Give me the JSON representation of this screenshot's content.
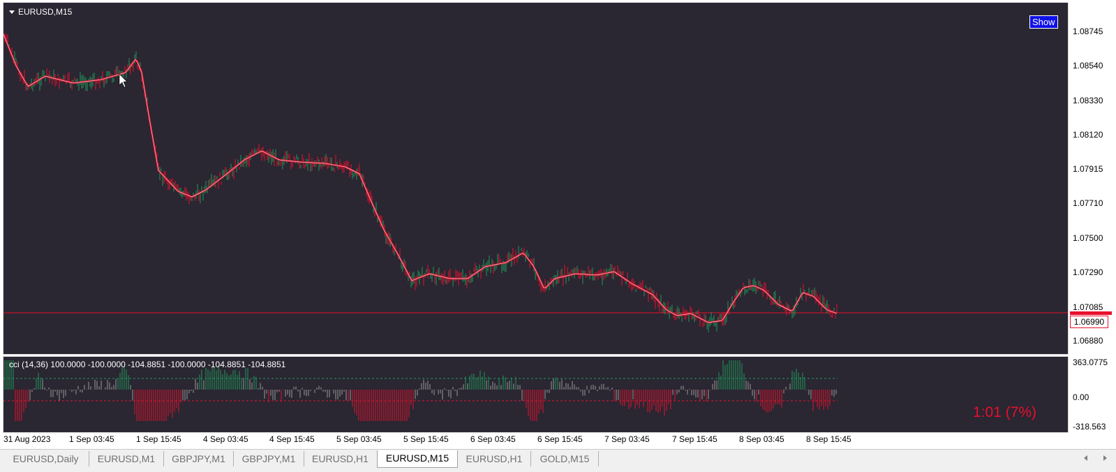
{
  "chart": {
    "symbol": "EURUSD,M15",
    "show_button": "Show",
    "price_axis": [
      "1.08745",
      "1.08540",
      "1.08330",
      "1.08120",
      "1.07915",
      "1.07710",
      "1.07500",
      "1.07290",
      "1.07085",
      "1.06880"
    ],
    "current_price": "1.06990",
    "time_axis": [
      "31 Aug 2023",
      "1 Sep 03:45",
      "1 Sep 15:45",
      "4 Sep 03:45",
      "4 Sep 15:45",
      "5 Sep 03:45",
      "5 Sep 15:45",
      "6 Sep 03:45",
      "6 Sep 15:45",
      "7 Sep 03:45",
      "7 Sep 15:45",
      "8 Sep 03:45",
      "8 Sep 15:45"
    ],
    "colors": {
      "background": "#2a2632",
      "bull": "#1f9a5a",
      "bear": "#e8102c",
      "ma_line": "#e8102c",
      "price_line": "#e8102c"
    }
  },
  "indicator": {
    "title": "cci  (14,36) 100.0000 -100.0000 -104.8851 -100.0000 -104.8851 -104.8851",
    "axis": [
      "363.0775",
      "0.00",
      "-318.563"
    ],
    "timer": "1:01 (7%)"
  },
  "tabs": [
    {
      "label": "EURUSD,Daily",
      "active": false
    },
    {
      "label": "EURUSD,M1",
      "active": false
    },
    {
      "label": "GBPJPY,M1",
      "active": false
    },
    {
      "label": "GBPJPY,M1",
      "active": false
    },
    {
      "label": "EURUSD,H1",
      "active": false
    },
    {
      "label": "EURUSD,M15",
      "active": true
    },
    {
      "label": "EURUSD,H1",
      "active": false
    },
    {
      "label": "GOLD,M15",
      "active": false
    }
  ]
}
